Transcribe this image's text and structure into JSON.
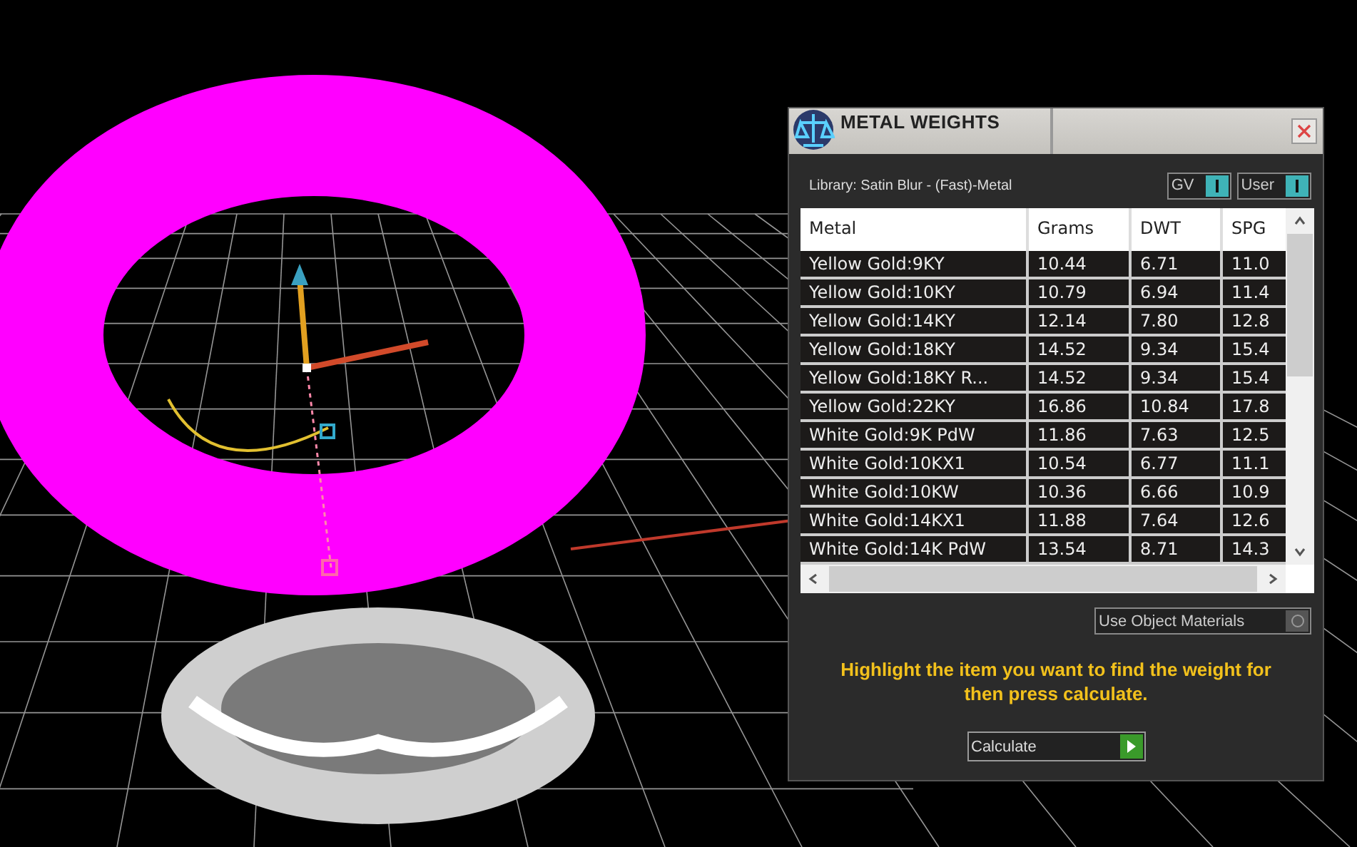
{
  "window": {
    "title": "METAL WEIGHTS"
  },
  "library": {
    "label": "Library: Satin Blur - (Fast)-Metal"
  },
  "toggles": [
    {
      "label": "GV",
      "on": true
    },
    {
      "label": "User",
      "on": true
    }
  ],
  "table": {
    "columns": [
      "Metal",
      "Grams",
      "DWT",
      "SPG"
    ],
    "rows": [
      [
        "Yellow Gold:9KY",
        "10.44",
        "6.71",
        "11.0"
      ],
      [
        "Yellow Gold:10KY",
        "10.79",
        "6.94",
        "11.4"
      ],
      [
        "Yellow Gold:14KY",
        "12.14",
        "7.80",
        "12.8"
      ],
      [
        "Yellow Gold:18KY",
        "14.52",
        "9.34",
        "15.4"
      ],
      [
        "Yellow Gold:18KY R...",
        "14.52",
        "9.34",
        "15.4"
      ],
      [
        "Yellow Gold:22KY",
        "16.86",
        "10.84",
        "17.8"
      ],
      [
        "White Gold:9K PdW",
        "11.86",
        "7.63",
        "12.5"
      ],
      [
        "White Gold:10KX1",
        "10.54",
        "6.77",
        "11.1"
      ],
      [
        "White Gold:10KW",
        "10.36",
        "6.66",
        "10.9"
      ],
      [
        "White Gold:14KX1",
        "11.88",
        "7.64",
        "12.6"
      ],
      [
        "White Gold:14K PdW",
        "13.54",
        "8.71",
        "14.3"
      ]
    ]
  },
  "use_object_materials": {
    "label": "Use Object Materials",
    "on": false
  },
  "hint": "Highlight the item you want to find the weight for then press calculate.",
  "calculate_button": {
    "label": "Calculate"
  }
}
